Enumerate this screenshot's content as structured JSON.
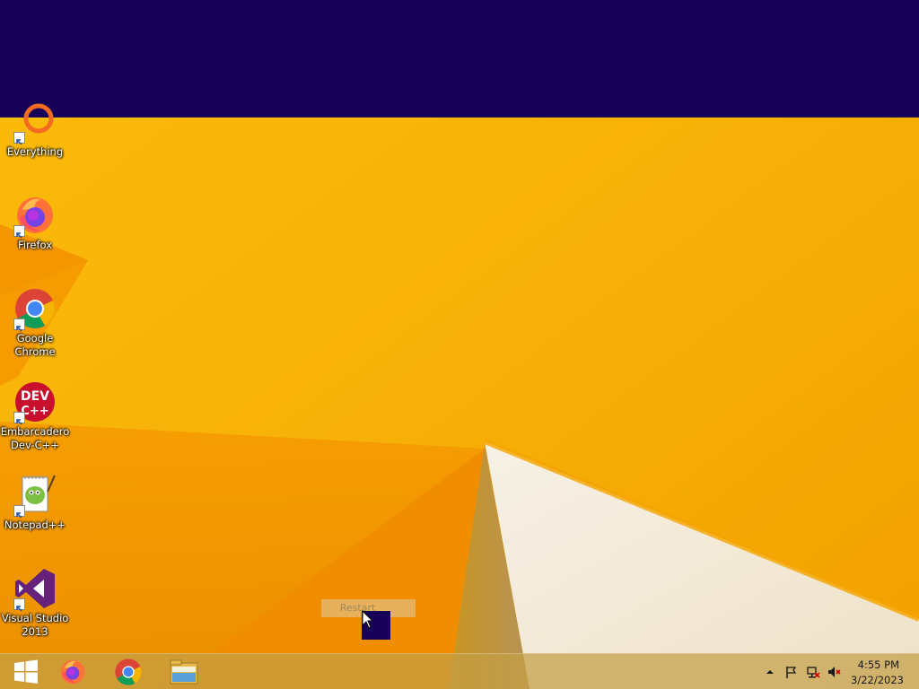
{
  "desktop": {
    "icons": [
      {
        "label": "Everything"
      },
      {
        "label": "Firefox"
      },
      {
        "label": "Google Chrome"
      },
      {
        "label": "Embarcadero Dev-C++",
        "badge_text": "DEV",
        "badge_sub": "C++"
      },
      {
        "label": "Notepad++"
      },
      {
        "label": "Visual Studio 2013"
      }
    ]
  },
  "overlay": {
    "restart_label": "Restart",
    "banner_color": "#170057"
  },
  "taskbar": {
    "pinned": [
      {
        "name": "start-button",
        "icon": "windows-logo-icon"
      },
      {
        "name": "firefox",
        "icon": "firefox-icon"
      },
      {
        "name": "chrome",
        "icon": "chrome-icon"
      },
      {
        "name": "file-explorer",
        "icon": "folder-icon"
      }
    ],
    "tray": {
      "time": "4:55 PM",
      "date": "3/22/2023"
    }
  },
  "colors": {
    "wallpaper_base": "#f6ad00",
    "wallpaper_light": "#fbc21a",
    "wallpaper_dark": "#f08a00",
    "accent_dark": "#170057"
  }
}
